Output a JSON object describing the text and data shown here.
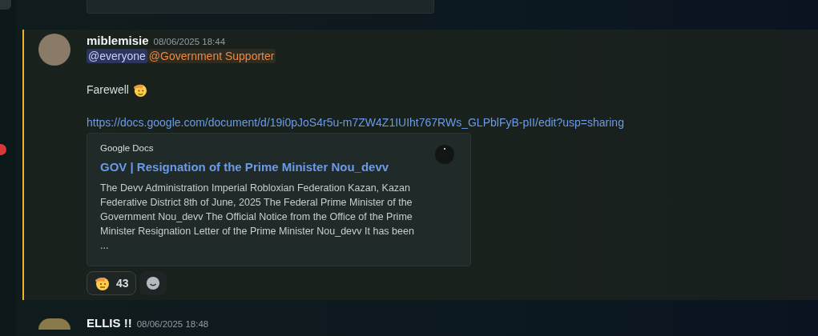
{
  "message": {
    "author": "miblemisie",
    "timestamp": "08/06/2025 18:44",
    "highlighted": true,
    "mentions": [
      {
        "text": "@everyone",
        "kind": "everyone"
      },
      {
        "text": "@Government Supporter",
        "kind": "role",
        "color": "#f0883e"
      }
    ],
    "text": "Farewell",
    "link": "https://docs.google.com/document/d/19i0pJoS4r5u-m7ZW4Z1IUIht767RWs_GLPblFyB-pII/edit?usp=sharing",
    "embed": {
      "provider": "Google Docs",
      "title": "GOV | Resignation of the Prime Minister Nou_devv",
      "description": "The Devv Administration Imperial Robloxian Federation Kazan, Kazan Federative District 8th of June, 2025 The Federal Prime Minister of the Government Nou_devv The Official Notice from the Office of the Prime Minister Resignation Letter of the Prime Minister Nou_devv It has been ..."
    },
    "reactions": [
      {
        "count": "43"
      }
    ]
  },
  "next_message": {
    "author": "ELLIS !!",
    "timestamp": "08/06/2025 18:48"
  }
}
